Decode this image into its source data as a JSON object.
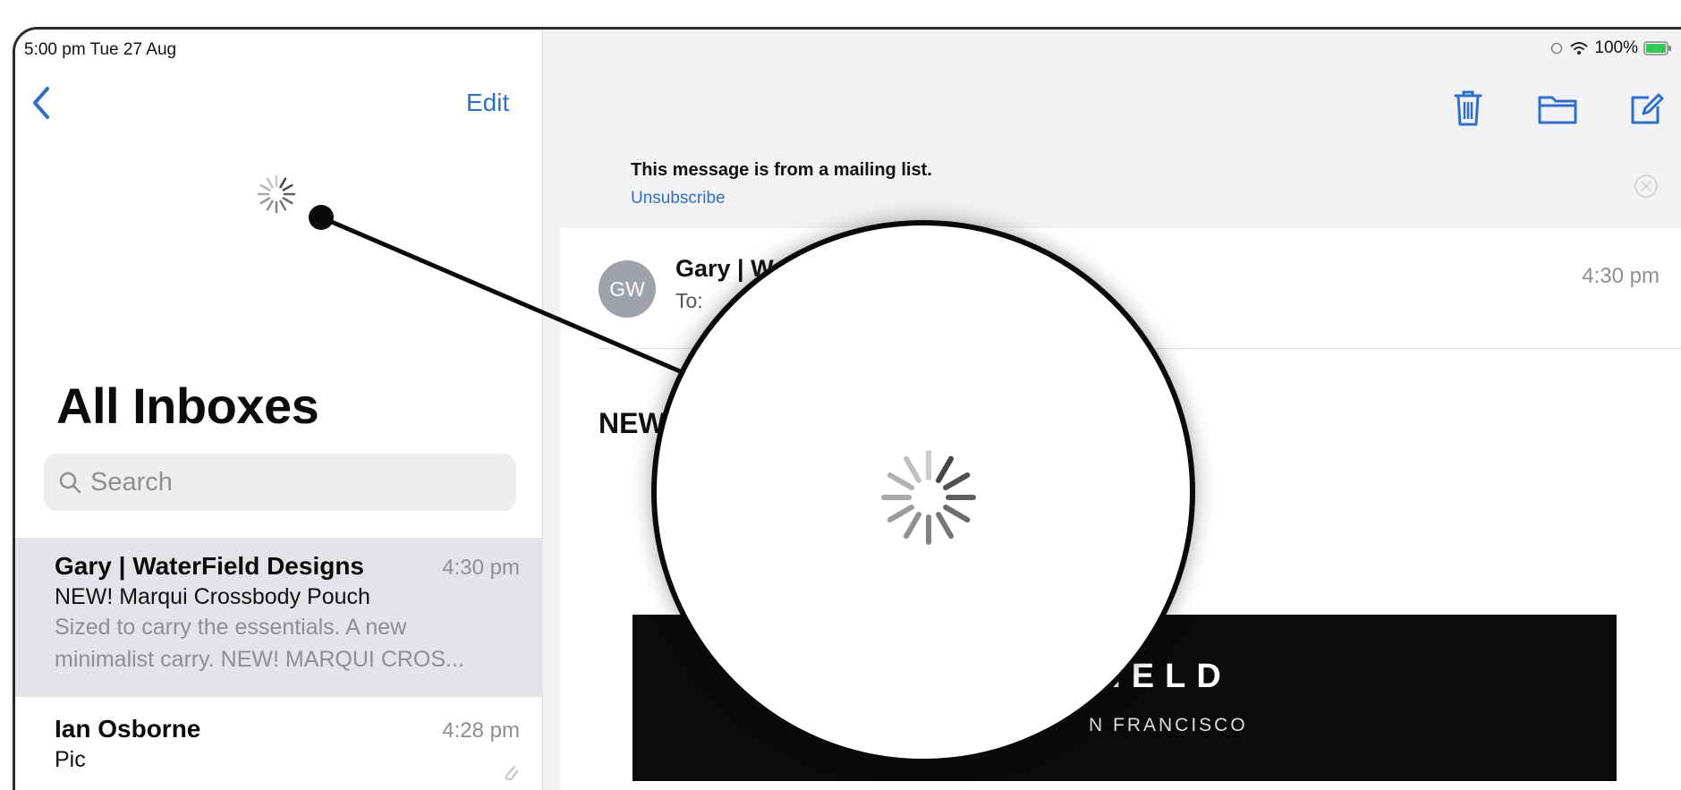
{
  "status_bar": {
    "time_date": "5:00 pm  Tue 27 Aug",
    "battery": "100%"
  },
  "sidebar": {
    "edit_label": "Edit",
    "title": "All Inboxes",
    "search_placeholder": "Search",
    "messages": [
      {
        "sender": "Gary | WaterField Designs",
        "time": "4:30 pm",
        "subject": "NEW! Marqui Crossbody Pouch",
        "preview_line1": "Sized to carry the essentials. A new",
        "preview_line2": "minimalist carry. NEW! MARQUI CROS..."
      },
      {
        "sender": "Ian Osborne",
        "time": "4:28 pm",
        "subject": "Pic"
      }
    ]
  },
  "detail": {
    "banner_text": "This message is from a mailing list.",
    "unsubscribe_label": "Unsubscribe",
    "avatar_initials": "GW",
    "sender_partial": "Gary | W",
    "to_label": "To:",
    "time": "4:30 pm",
    "subject_partial": "NEW",
    "brand_name_partial": "FIELD",
    "brand_city_partial": "N FRANCISCO"
  },
  "icons": {
    "back": "chevron-left-icon",
    "trash": "trash-icon",
    "folder": "folder-icon",
    "compose": "compose-icon",
    "spinner": "loading-spinner-icon"
  },
  "colors": {
    "accent": "#2f6fc9",
    "selected_row": "#e4e3e7",
    "battery_green": "#34c759"
  }
}
